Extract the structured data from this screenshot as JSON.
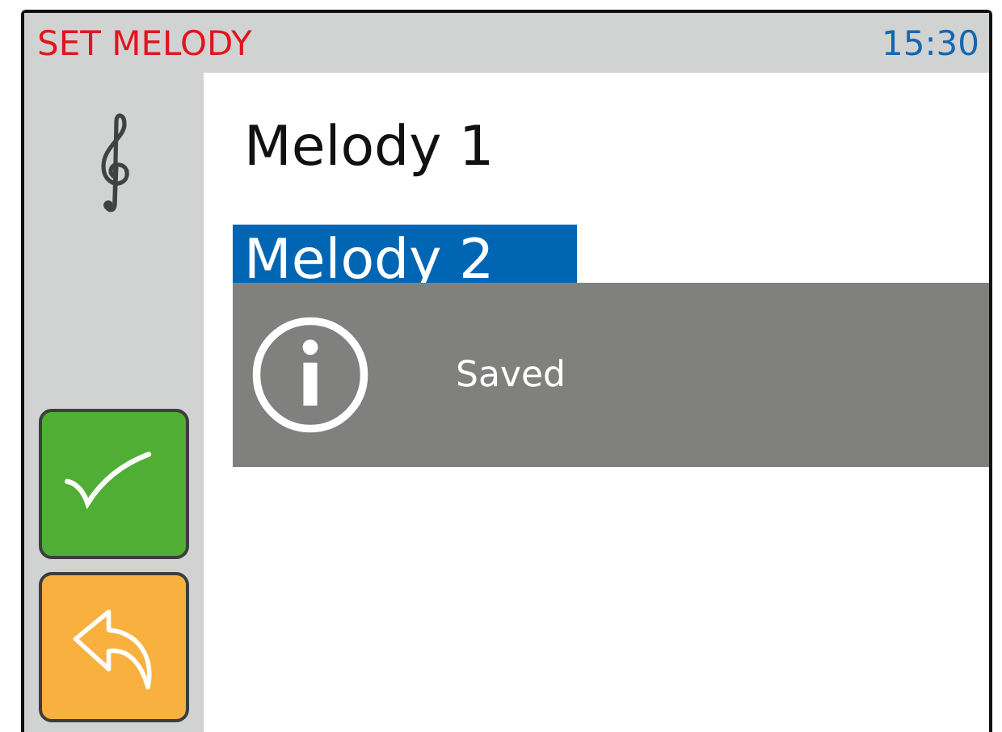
{
  "header": {
    "title": "SET MELODY",
    "time": "15:30"
  },
  "melodies": [
    {
      "label": "Melody 1",
      "selected": false
    },
    {
      "label": "Melody 2",
      "selected": true
    }
  ],
  "actions": [
    {
      "kind": "confirm"
    },
    {
      "kind": "back"
    }
  ],
  "toast": {
    "kind": "info",
    "message": "Saved"
  }
}
